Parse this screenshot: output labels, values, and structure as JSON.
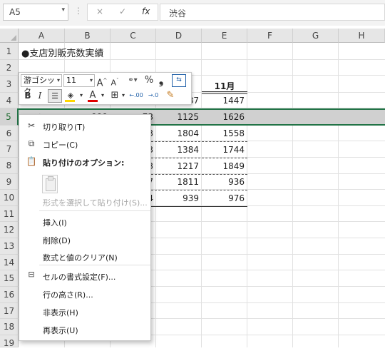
{
  "formula_bar": {
    "name_box": "A5",
    "fx": "fx",
    "cancel": "×",
    "enter": "✓",
    "value": "渋谷"
  },
  "columns": [
    "A",
    "B",
    "C",
    "D",
    "E",
    "F",
    "G",
    "H"
  ],
  "rows": [
    "1",
    "2",
    "3",
    "4",
    "5",
    "6",
    "7",
    "8",
    "9",
    "10",
    "11",
    "12",
    "13",
    "14",
    "15",
    "16",
    "17",
    "18",
    "19"
  ],
  "sheet": {
    "title": "●支店別販売数実績",
    "header_e3": "11月",
    "a5_partial": "渋谷",
    "b5_partial": "999",
    "c_partials": [
      "87",
      "73",
      "3",
      "3",
      "3",
      "7",
      "4"
    ],
    "d_values": [
      "1125",
      "1804",
      "1384",
      "1217",
      "1811",
      "939"
    ],
    "e_values": [
      "1447",
      "1626",
      "1558",
      "1744",
      "1849",
      "936",
      "976"
    ]
  },
  "mini_toolbar": {
    "font_name": "游ゴシック",
    "font_size": "11",
    "grow_font": "A",
    "shrink_font": "A",
    "percent": "%",
    "comma": "❟",
    "bold": "B",
    "italic": "I",
    "font_color": "A",
    "dec_inc": ".00",
    "dec_dec": ".0",
    "colors": {
      "fill": "#ffd700",
      "font": "#e00000"
    }
  },
  "context_menu": {
    "cut": "切り取り(T)",
    "copy": "コピー(C)",
    "paste_options": "貼り付けのオプション:",
    "paste_special": "形式を選択して貼り付け(S)...",
    "insert": "挿入(I)",
    "delete": "削除(D)",
    "clear": "数式と値のクリア(N)",
    "format_cells": "セルの書式設定(F)...",
    "row_height": "行の高さ(R)...",
    "hide": "非表示(H)",
    "unhide": "再表示(U)"
  },
  "colors": {
    "accent": "#217346",
    "selection": "#d0d0d0"
  }
}
